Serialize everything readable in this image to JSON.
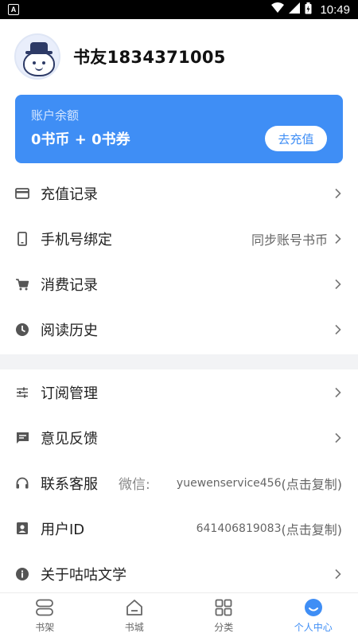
{
  "status_bar": {
    "app_icon": "A",
    "time": "10:49",
    "icons": [
      "wifi-icon",
      "signal-icon",
      "battery-icon"
    ]
  },
  "profile": {
    "username": "书友1834371005"
  },
  "balance": {
    "label": "账户余额",
    "value": "0书币 + 0书券",
    "recharge_label": "去充值",
    "accent_color": "#3f8ef5"
  },
  "menu": {
    "recharge_records": {
      "label": "充值记录",
      "icon": "card-icon"
    },
    "phone_binding": {
      "label": "手机号绑定",
      "right_text": "同步账号书币",
      "icon": "phone-icon"
    },
    "consumption_records": {
      "label": "消费记录",
      "icon": "cart-icon"
    },
    "reading_history": {
      "label": "阅读历史",
      "icon": "clock-icon"
    },
    "subscription_management": {
      "label": "订阅管理",
      "icon": "sliders-icon"
    },
    "feedback": {
      "label": "意见反馈",
      "icon": "message-icon"
    },
    "customer_service": {
      "label": "联系客服",
      "sub": "微信:",
      "value": "yuewenservice456",
      "suffix": "(点击复制)",
      "icon": "headset-icon"
    },
    "user_id": {
      "label": "用户ID",
      "value": "641406819083",
      "suffix": "(点击复制)",
      "icon": "user-badge-icon"
    },
    "about": {
      "label": "关于咕咕文学",
      "icon": "info-icon"
    }
  },
  "bottom_nav": {
    "items": [
      {
        "label": "书架",
        "icon": "bookshelf-icon"
      },
      {
        "label": "书城",
        "icon": "store-icon"
      },
      {
        "label": "分类",
        "icon": "grid-icon"
      },
      {
        "label": "个人中心",
        "icon": "profile-icon"
      }
    ],
    "active_index": 3
  }
}
